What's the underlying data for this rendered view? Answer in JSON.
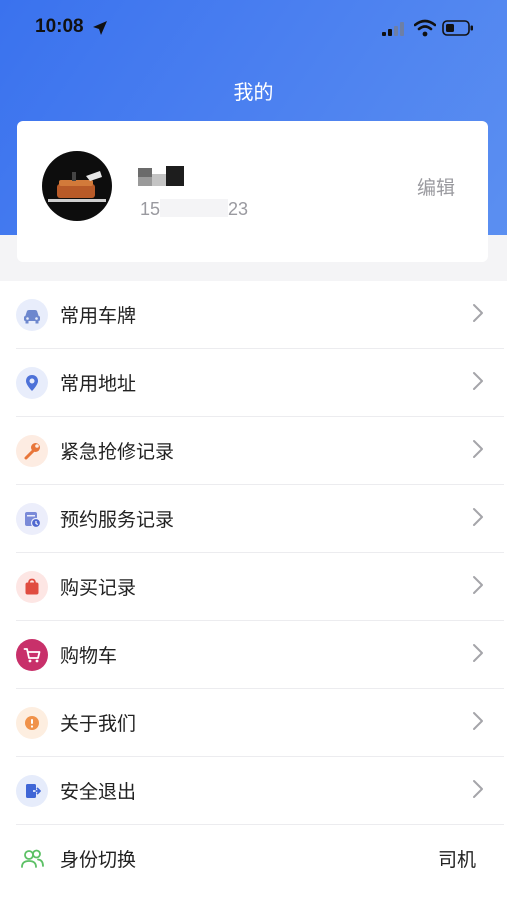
{
  "status_bar": {
    "time": "10:08"
  },
  "header": {
    "title": "我的"
  },
  "profile": {
    "phone_prefix": "15",
    "phone_suffix": "23",
    "edit_label": "编辑"
  },
  "menu": [
    {
      "label": "常用车牌",
      "icon": "car-icon"
    },
    {
      "label": "常用地址",
      "icon": "location-pin-icon"
    },
    {
      "label": "紧急抢修记录",
      "icon": "wrench-icon"
    },
    {
      "label": "预约服务记录",
      "icon": "calendar-clock-icon"
    },
    {
      "label": "购买记录",
      "icon": "shopping-bag-icon"
    },
    {
      "label": "购物车",
      "icon": "cart-icon"
    },
    {
      "label": "关于我们",
      "icon": "info-icon"
    },
    {
      "label": "安全退出",
      "icon": "exit-icon"
    },
    {
      "label": "身份切换",
      "icon": "users-icon",
      "value": "司机"
    }
  ],
  "colors": {
    "header_blue": "#4a7ff0",
    "accent_green": "#5cc065"
  }
}
